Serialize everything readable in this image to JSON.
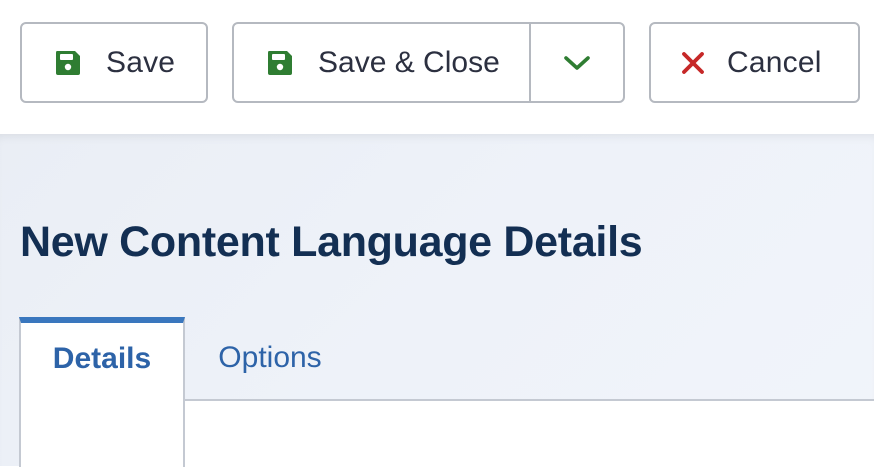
{
  "toolbar": {
    "save_label": "Save",
    "save_close_label": "Save & Close",
    "cancel_label": "Cancel"
  },
  "page": {
    "title": "New Content Language Details"
  },
  "tabs": [
    {
      "label": "Details",
      "active": true
    },
    {
      "label": "Options",
      "active": false
    }
  ],
  "colors": {
    "save_icon": "#2f7d32",
    "cancel_icon": "#c62828",
    "title": "#132f53",
    "tab_accent": "#3a77be",
    "tab_text": "#2d63a8"
  },
  "icons": {
    "save": "floppy-disk-icon",
    "save_close": "floppy-disk-icon",
    "dropdown": "chevron-down-icon",
    "cancel": "close-icon"
  }
}
